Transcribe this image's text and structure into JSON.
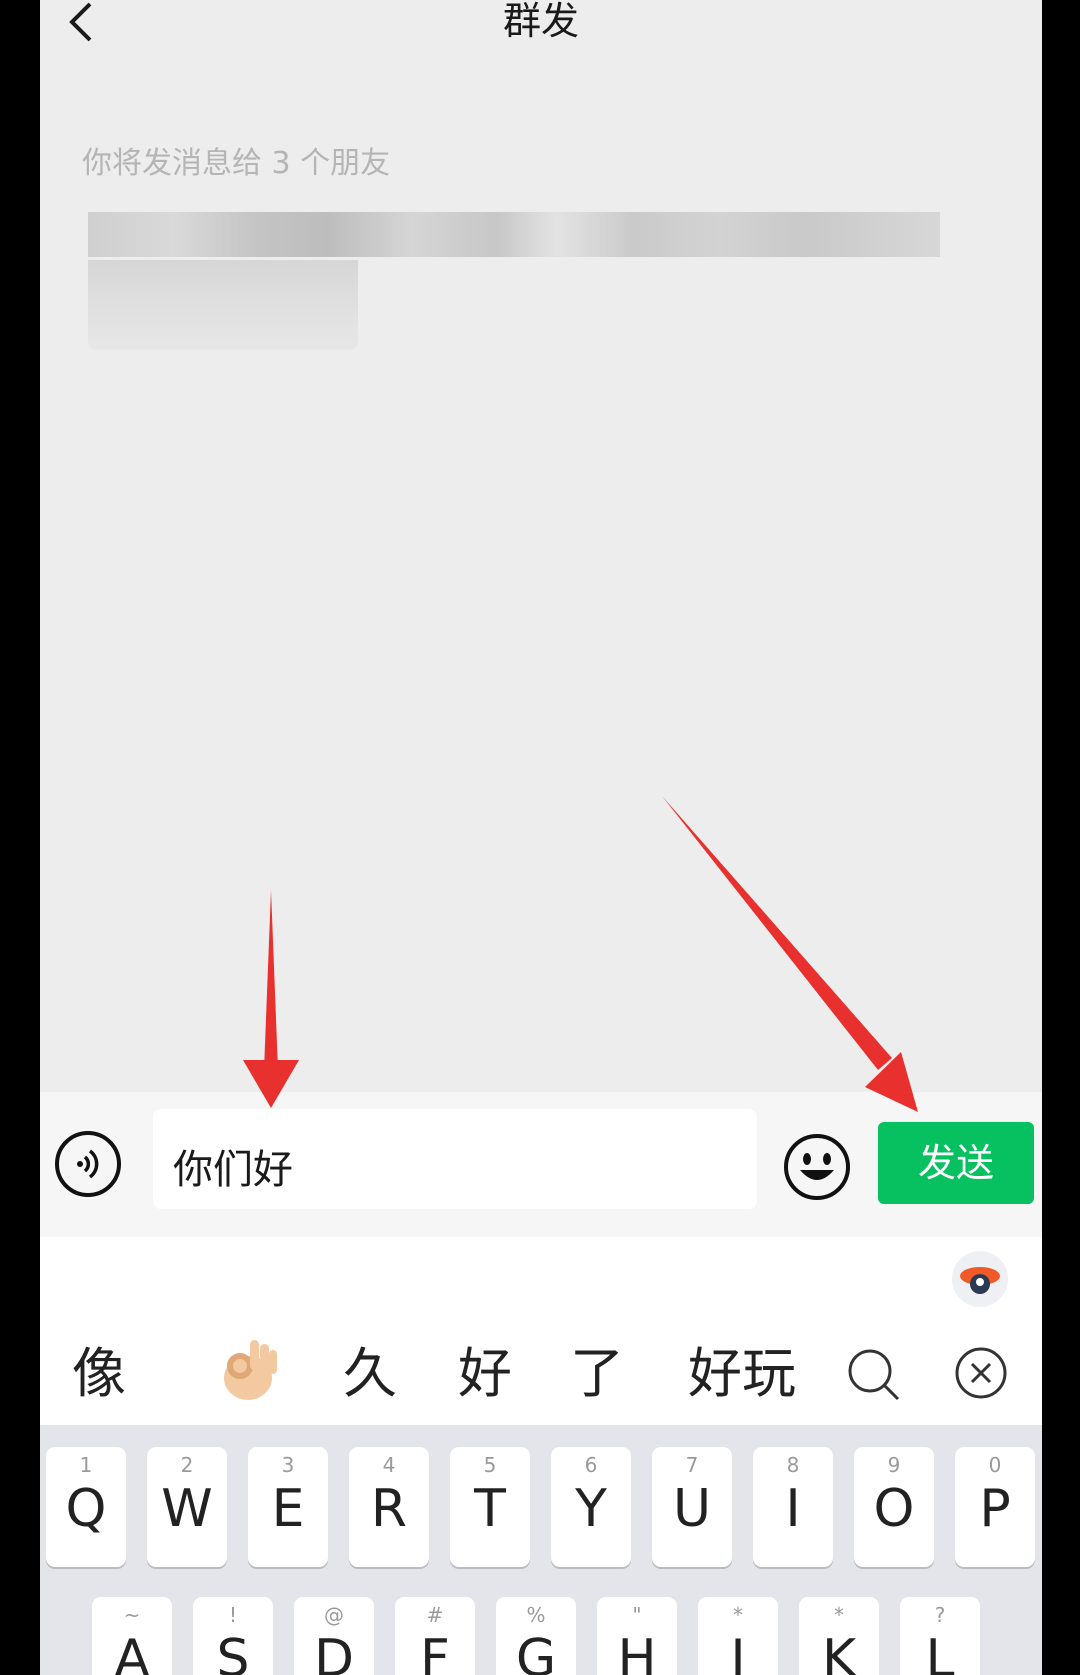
{
  "header": {
    "title": "群发",
    "back_icon": "chevron-left-icon"
  },
  "recipients": {
    "note": "你将发消息给 3 个朋友"
  },
  "input_bar": {
    "voice_icon": "voice-icon",
    "text_value": "你们好",
    "emoji_icon": "smiley-icon",
    "send_label": "发送",
    "send_color": "#07c160"
  },
  "candidates": {
    "assistant_icon": "input-assistant-icon",
    "items": [
      "像",
      "👌",
      "久",
      "好",
      "了",
      "好玩"
    ],
    "search_icon": "search-icon",
    "close_icon": "close-circle-icon"
  },
  "keyboard": {
    "row1": [
      {
        "letter": "Q",
        "hint": "1"
      },
      {
        "letter": "W",
        "hint": "2"
      },
      {
        "letter": "E",
        "hint": "3"
      },
      {
        "letter": "R",
        "hint": "4"
      },
      {
        "letter": "T",
        "hint": "5"
      },
      {
        "letter": "Y",
        "hint": "6"
      },
      {
        "letter": "U",
        "hint": "7"
      },
      {
        "letter": "I",
        "hint": "8"
      },
      {
        "letter": "O",
        "hint": "9"
      },
      {
        "letter": "P",
        "hint": "0"
      }
    ],
    "row2": [
      {
        "letter": "A",
        "hint": "~"
      },
      {
        "letter": "S",
        "hint": "!"
      },
      {
        "letter": "D",
        "hint": "@"
      },
      {
        "letter": "F",
        "hint": "#"
      },
      {
        "letter": "G",
        "hint": "%"
      },
      {
        "letter": "H",
        "hint": "\""
      },
      {
        "letter": "J",
        "hint": "*"
      },
      {
        "letter": "K",
        "hint": "*"
      },
      {
        "letter": "L",
        "hint": "?"
      }
    ]
  },
  "annotation_color": "#e8312f"
}
